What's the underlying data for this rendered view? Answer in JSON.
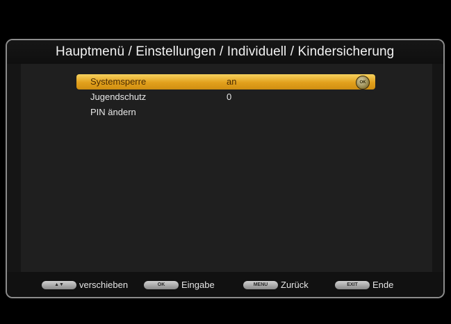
{
  "header": {
    "title": "Hauptmenü / Einstellungen / Individuell / Kindersicherung"
  },
  "menu": {
    "items": [
      {
        "label": "Systemsperre",
        "value": "an",
        "selected": true,
        "ok_icon": "ok-icon"
      },
      {
        "label": "Jugendschutz",
        "value": "0",
        "selected": false
      },
      {
        "label": "PIN ändern",
        "value": "",
        "selected": false
      }
    ]
  },
  "footer": {
    "hints": [
      {
        "key": "▲▼",
        "text": "verschieben"
      },
      {
        "key": "OK",
        "text": "Eingabe"
      },
      {
        "key": "MENU",
        "text": "Zurück"
      },
      {
        "key": "EXIT",
        "text": "Ende"
      }
    ]
  },
  "colors": {
    "highlight": "#e6a825",
    "background": "#1f1f1f",
    "frame_border": "#8c8c8c"
  }
}
